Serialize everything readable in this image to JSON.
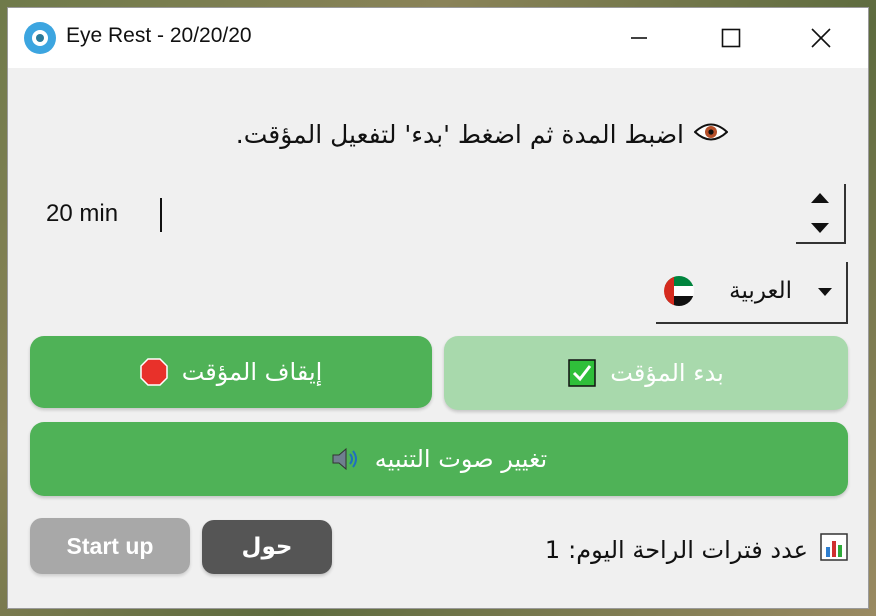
{
  "window": {
    "title": "Eye Rest - 20/20/20"
  },
  "info_text": "اضبط المدة ثم اضغط 'بدء' لتفعيل المؤقت.",
  "duration": {
    "value": "20 min"
  },
  "language": {
    "selected": "العربية"
  },
  "buttons": {
    "stop": "إيقاف المؤقت",
    "start": "بدء المؤقت",
    "sound": "تغيير صوت التنبيه",
    "startup": "Start up",
    "about": "حول"
  },
  "rest_count": {
    "label": "عدد فترات الراحة اليوم:",
    "value": "1"
  },
  "icons": {
    "app": "eye-app-icon",
    "info": "eye-icon",
    "flag": "uae-flag-icon",
    "stop": "stop-sign-icon",
    "start": "check-box-icon",
    "sound": "speaker-icon",
    "count": "bar-chart-icon"
  },
  "colors": {
    "primary_green": "#4fb257",
    "disabled_green": "#a8d9ac",
    "startup_gray": "#a8a8a8",
    "about_dark": "#555555"
  }
}
